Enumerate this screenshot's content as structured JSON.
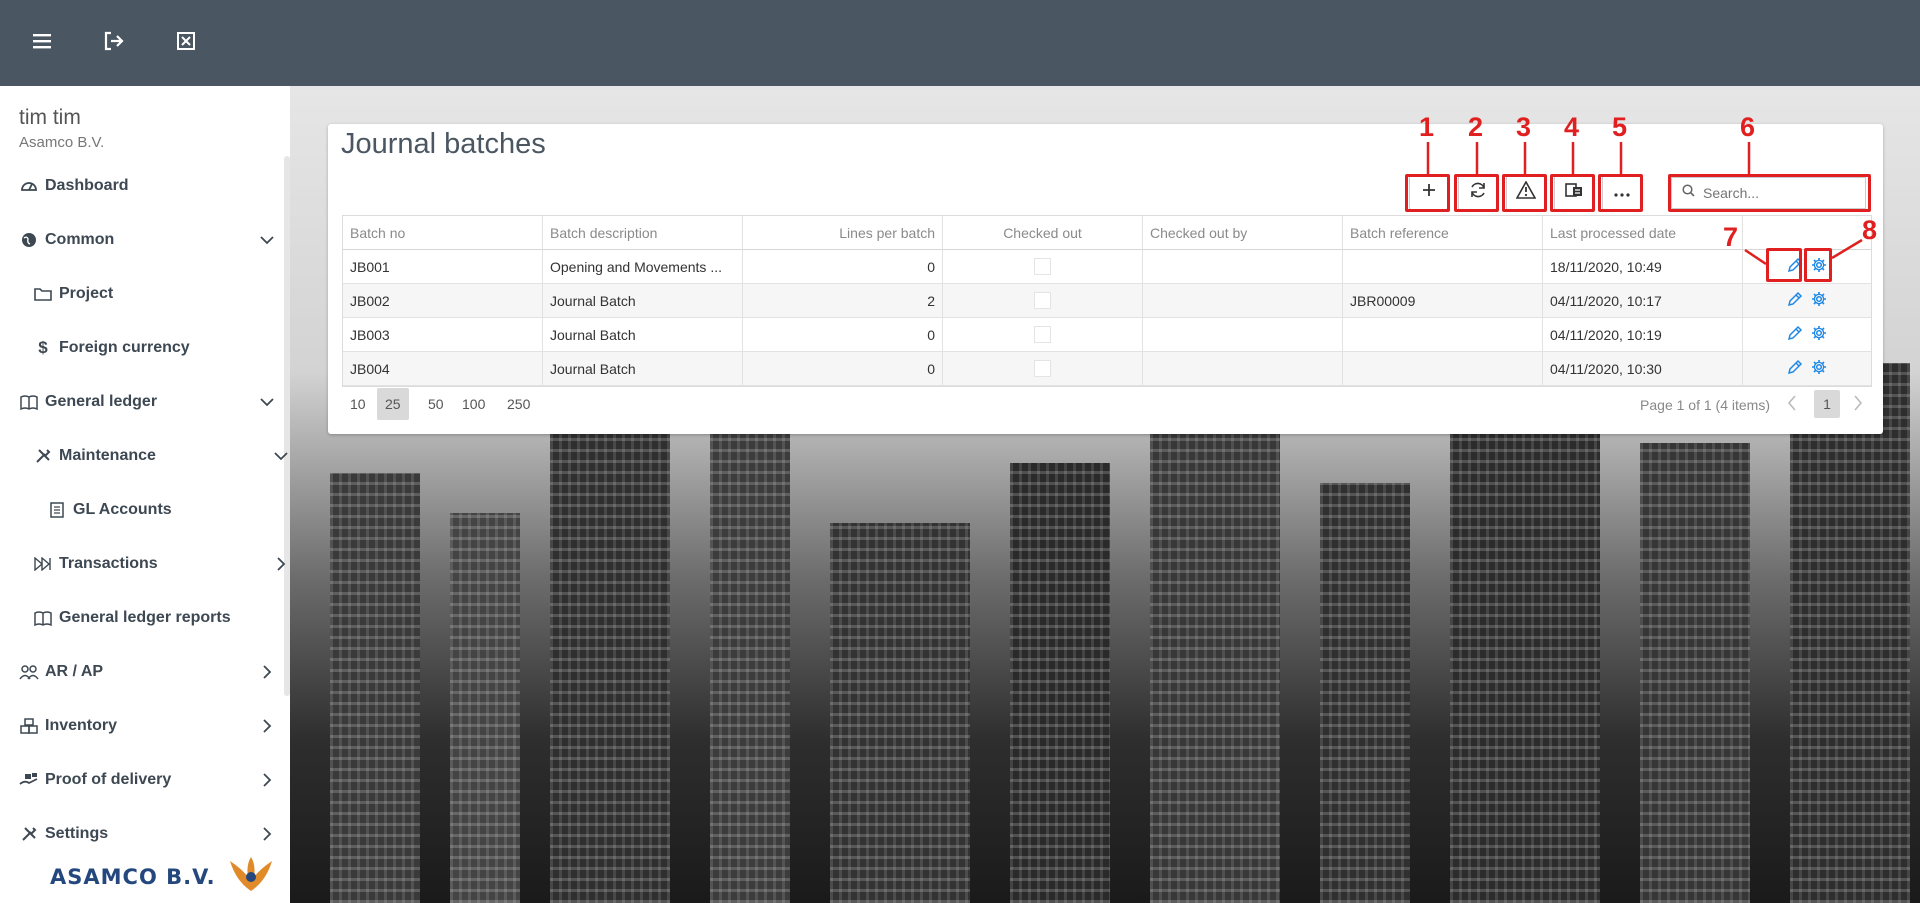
{
  "topbar": {
    "buttons": [
      {
        "icon": "menu-icon"
      },
      {
        "icon": "logout-icon"
      },
      {
        "icon": "close-window-icon"
      }
    ]
  },
  "sidebar": {
    "user_name": "tim tim",
    "company": "Asamco B.V.",
    "items": [
      {
        "label": "Dashboard",
        "icon": "dashboard-icon"
      },
      {
        "label": "Common",
        "icon": "globe-icon",
        "expanded": true
      },
      {
        "label": "Project",
        "icon": "folder-icon"
      },
      {
        "label": "Foreign currency",
        "icon": "dollar-icon"
      },
      {
        "label": "General ledger",
        "icon": "book-icon",
        "expanded": true
      },
      {
        "label": "Maintenance",
        "icon": "tools-icon",
        "expanded": true
      },
      {
        "label": "GL Accounts",
        "icon": "list-icon"
      },
      {
        "label": "Transactions",
        "icon": "transactions-icon"
      },
      {
        "label": "General ledger reports",
        "icon": "book-icon"
      },
      {
        "label": "AR / AP",
        "icon": "users-icon"
      },
      {
        "label": "Inventory",
        "icon": "boxes-icon"
      },
      {
        "label": "Proof of delivery",
        "icon": "delivery-icon"
      },
      {
        "label": "Settings",
        "icon": "tools-icon"
      }
    ],
    "logo_text": "ASAMCO B.V."
  },
  "main": {
    "title": "Journal batches",
    "toolbar": {
      "add_icon": "plus-icon",
      "refresh_icon": "refresh-icon",
      "warning_icon": "warning-icon",
      "layout_icon": "column-chooser-icon",
      "more_icon": "more-icon",
      "search_placeholder": "Search..."
    },
    "callouts": [
      "1",
      "2",
      "3",
      "4",
      "5",
      "6",
      "7",
      "8"
    ],
    "columns": [
      "Batch no",
      "Batch description",
      "Lines per batch",
      "Checked out",
      "Checked out by",
      "Batch reference",
      "Last processed date"
    ],
    "rows": [
      {
        "batch_no": "JB001",
        "description": "Opening and Movements ...",
        "lines": "0",
        "checked_out": false,
        "checked_out_by": "",
        "reference": "",
        "last_processed": "18/11/2020, 10:49"
      },
      {
        "batch_no": "JB002",
        "description": "Journal Batch",
        "lines": "2",
        "checked_out": false,
        "checked_out_by": "",
        "reference": "JBR00009",
        "last_processed": "04/11/2020, 10:17"
      },
      {
        "batch_no": "JB003",
        "description": "Journal Batch",
        "lines": "0",
        "checked_out": false,
        "checked_out_by": "",
        "reference": "",
        "last_processed": "04/11/2020, 10:19"
      },
      {
        "batch_no": "JB004",
        "description": "Journal Batch",
        "lines": "0",
        "checked_out": false,
        "checked_out_by": "",
        "reference": "",
        "last_processed": "04/11/2020, 10:30"
      }
    ],
    "pager": {
      "page_sizes": [
        "10",
        "25",
        "50",
        "100",
        "250"
      ],
      "selected_size": "25",
      "info": "Page 1 of 1 (4 items)",
      "current_page": "1"
    }
  },
  "colors": {
    "topbar": "#4a5661",
    "accent": "#1e88e5",
    "callout": "#e02020"
  }
}
